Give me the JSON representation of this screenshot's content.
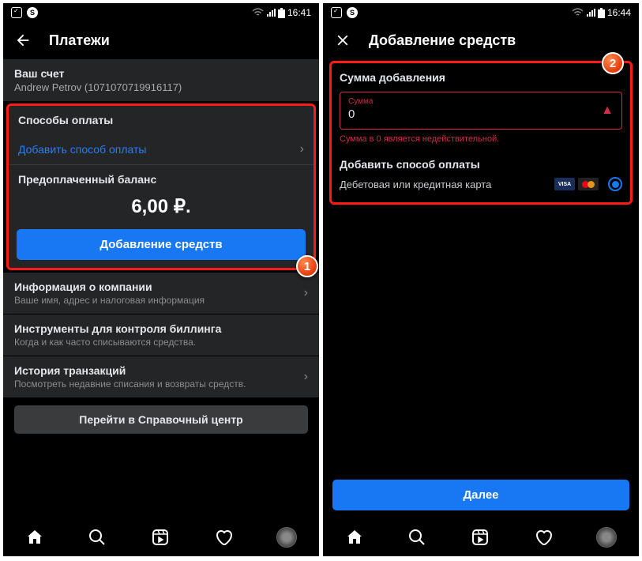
{
  "left": {
    "status_time": "16:41",
    "header_title": "Платежи",
    "account_label": "Ваш счет",
    "account_value": "Andrew Petrov (1071070719916117)",
    "pay_methods_title": "Способы оплаты",
    "add_method_link": "Добавить способ оплаты",
    "prepaid_label": "Предоплаченный баланс",
    "balance": "6,00 ₽.",
    "add_funds_btn": "Добавление средств",
    "company_title": "Информация о компании",
    "company_sub": "Ваше имя, адрес и налоговая информация",
    "billing_title": "Инструменты для контроля биллинга",
    "billing_sub": "Когда и как часто списываются средства.",
    "history_title": "История транзакций",
    "history_sub": "Посмотреть недавние списания и возвраты средств.",
    "help_btn": "Перейти в Справочный центр",
    "badge": "1"
  },
  "right": {
    "status_time": "16:44",
    "header_title": "Добавление средств",
    "amount_label": "Сумма добавления",
    "input_placeholder": "Сумма",
    "input_value": "0",
    "error": "Сумма в 0 является недействительной.",
    "add_method_title": "Добавить способ оплаты",
    "card_label": "Дебетовая или кредитная карта",
    "visa": "VISA",
    "next_btn": "Далее",
    "badge": "2"
  }
}
